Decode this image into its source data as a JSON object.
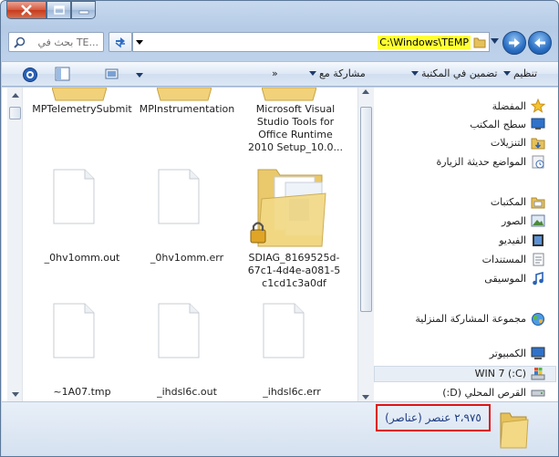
{
  "caption": {
    "close_icon": "close-icon",
    "maximize_icon": "maximize-icon",
    "minimize_icon": "minimize-icon"
  },
  "search": {
    "placeholder": "بحث في TE..."
  },
  "address": {
    "path": "C:\\Windows\\TEMP"
  },
  "toolbar": {
    "organize": "تنظيم",
    "include_in_library": "تضمين في المكتبة",
    "share_with": "مشاركة مع",
    "more": "»"
  },
  "files": [
    {
      "label": "MPTelemetrySubmit",
      "icon": "folder"
    },
    {
      "label": "MPInstrumentation",
      "icon": "folder"
    },
    {
      "label": "Microsoft Visual Studio Tools for Office Runtime 2010 Setup_10.0...",
      "icon": "folder"
    },
    {
      "label": "_0hv1omm.out",
      "icon": "file"
    },
    {
      "label": "_0hv1omm.err",
      "icon": "file"
    },
    {
      "label": "SDIAG_8169525d-67c1-4d4e-a081-5c1cd1c3a0df",
      "icon": "locked-folder"
    },
    {
      "label": "~1A07.tmp",
      "icon": "file"
    },
    {
      "label": "_ihdsl6c.out",
      "icon": "file"
    },
    {
      "label": "_ihdsl6c.err",
      "icon": "file"
    }
  ],
  "nav": {
    "favorites": "المفضلة",
    "desktop": "سطح المكتب",
    "downloads": "التنزيلات",
    "recent": "المواضع حديثة الزيارة",
    "libraries": "المكتبات",
    "pictures": "الصور",
    "videos": "الفيديو",
    "documents": "المستندات",
    "music": "الموسيقى",
    "homegroup": "مجموعة المشاركة المنزلية",
    "computer": "الكمبيوتر",
    "drive_c": "(C:) WIN 7",
    "drive_d": "القرص المحلي (D:)"
  },
  "status": {
    "count": "٢،٩٧٥ عنصر (عناصر)"
  }
}
